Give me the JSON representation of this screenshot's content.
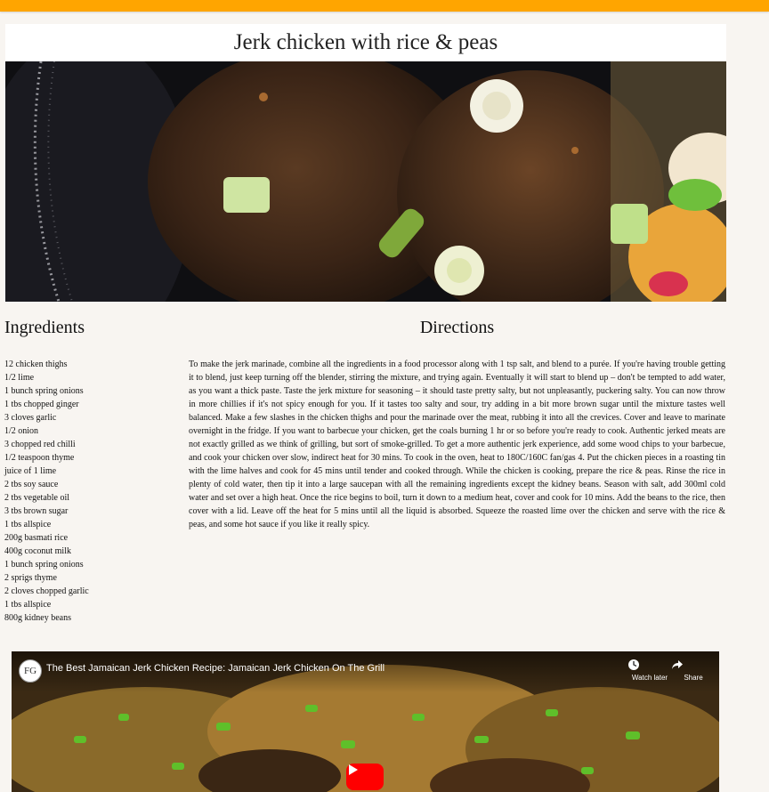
{
  "page": {
    "title": "Jerk chicken with rice & peas"
  },
  "hero": {
    "alt": "Jerk chicken"
  },
  "ingredients": {
    "heading": "Ingredients",
    "items": [
      "12 chicken thighs",
      "1/2 lime",
      "1 bunch spring onions",
      "1 tbs chopped ginger",
      "3 cloves garlic",
      "1/2 onion",
      "3 chopped red chilli",
      "1/2 teaspoon thyme",
      "juice of 1 lime",
      "2 tbs soy sauce",
      "2 tbs vegetable oil",
      "3 tbs brown sugar",
      "1 tbs allspice",
      "200g basmati rice",
      "400g coconut milk",
      "1 bunch spring onions",
      "2 sprigs thyme",
      "2 cloves chopped garlic",
      "1 tbs allspice",
      "800g kidney beans"
    ]
  },
  "directions": {
    "heading": "Directions",
    "text": "To make the jerk marinade, combine all the ingredients in a food processor along with 1 tsp salt, and blend to a purée. If you're having trouble getting it to blend, just keep turning off the blender, stirring the mixture, and trying again. Eventually it will start to blend up – don't be tempted to add water, as you want a thick paste. Taste the jerk mixture for seasoning – it should taste pretty salty, but not unpleasantly, puckering salty. You can now throw in more chillies if it's not spicy enough for you. If it tastes too salty and sour, try adding in a bit more brown sugar until the mixture tastes well balanced. Make a few slashes in the chicken thighs and pour the marinade over the meat, rubbing it into all the crevices. Cover and leave to marinate overnight in the fridge. If you want to barbecue your chicken, get the coals burning 1 hr or so before you're ready to cook. Authentic jerked meats are not exactly grilled as we think of grilling, but sort of smoke-grilled. To get a more authentic jerk experience, add some wood chips to your barbecue, and cook your chicken over slow, indirect heat for 30 mins. To cook in the oven, heat to 180C/160C fan/gas 4. Put the chicken pieces in a roasting tin with the lime halves and cook for 45 mins until tender and cooked through. While the chicken is cooking, prepare the rice & peas. Rinse the rice in plenty of cold water, then tip it into a large saucepan with all the remaining ingredients except the kidney beans. Season with salt, add 300ml cold water and set over a high heat. Once the rice begins to boil, turn it down to a medium heat, cover and cook for 10 mins. Add the beans to the rice, then cover with a lid. Leave off the heat for 5 mins until all the liquid is absorbed. Squeeze the roasted lime over the chicken and serve with the rice & peas, and some hot sauce if you like it really spicy."
  },
  "video": {
    "title": "The Best Jamaican Jerk Chicken Recipe: Jamaican Jerk Chicken On The Grill",
    "channel_initials": "FG",
    "watch_later_label": "Watch later",
    "share_label": "Share"
  },
  "colors": {
    "topbar": "#ffa500",
    "background": "#f8f5f1",
    "play_button": "#ff0000"
  }
}
